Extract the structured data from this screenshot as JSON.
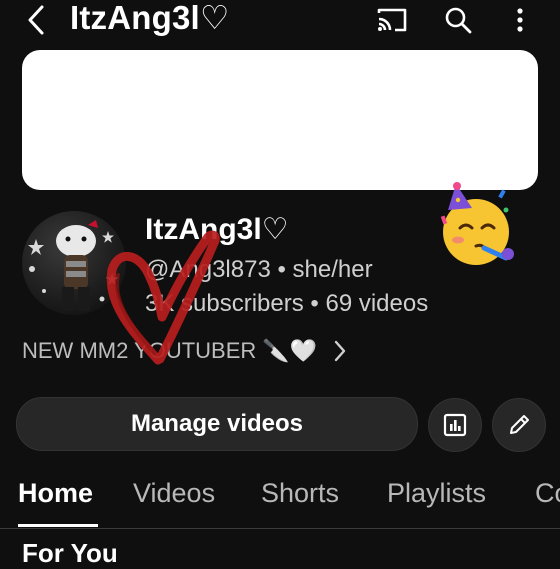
{
  "header": {
    "title": "ItzAng3l♡",
    "back_icon": "chevron-left-icon",
    "cast_icon": "cast-icon",
    "search_icon": "search-icon",
    "more_icon": "more-vertical-icon"
  },
  "channel": {
    "name": "ItzAng3l♡",
    "handle_pronouns": "@Ang3l873 • she/her",
    "stats": "3K subscribers • 69 videos",
    "description": "NEW MM2 YOUTUBER 🔪🤍",
    "emoji": "🥳"
  },
  "actions": {
    "manage_label": "Manage videos",
    "analytics_icon": "analytics-icon",
    "edit_icon": "pencil-icon"
  },
  "tabs": [
    {
      "label": "Home",
      "active": true
    },
    {
      "label": "Videos",
      "active": false
    },
    {
      "label": "Shorts",
      "active": false
    },
    {
      "label": "Playlists",
      "active": false
    },
    {
      "label": "Co",
      "active": false
    }
  ],
  "section": {
    "heading": "For You"
  },
  "colors": {
    "background": "#0f0f0f",
    "banner": "#ffffff",
    "button": "#272727",
    "doodle": "#b81d1d"
  }
}
